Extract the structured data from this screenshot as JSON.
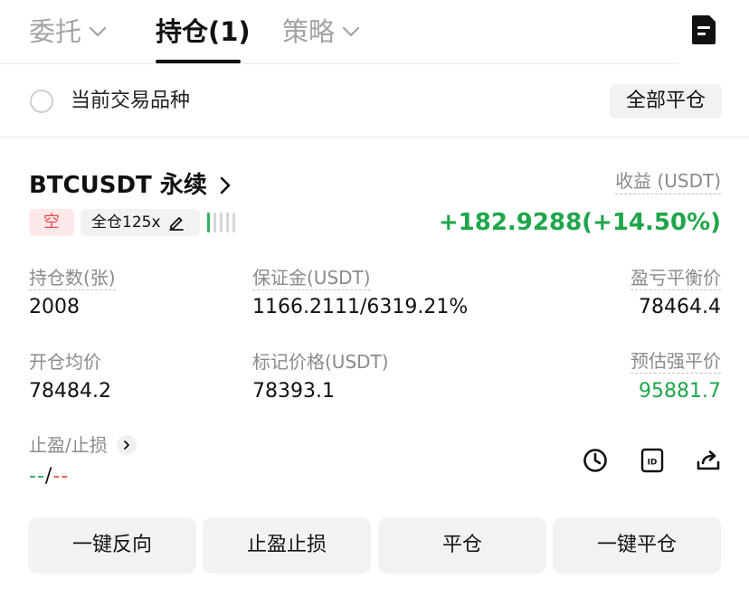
{
  "tabs": [
    {
      "label": "委托",
      "dropdown": true
    },
    {
      "label": "持仓(1)",
      "dropdown": false
    },
    {
      "label": "策略",
      "dropdown": true
    }
  ],
  "filter": {
    "current_symbol_label": "当前交易品种",
    "close_all_label": "全部平仓"
  },
  "position": {
    "symbol": "BTCUSDT 永续",
    "side": "空",
    "margin_mode": "全仓125x",
    "pnl_label": "收益 (USDT)",
    "pnl_value": "+182.9288(+14.50%)",
    "risk_bars_total": 5,
    "risk_bars_active": 1,
    "fields": {
      "size_label": "持仓数(张)",
      "size_value": "2008",
      "margin_label": "保证金(USDT)",
      "margin_value": "1166.2111/6319.21%",
      "breakeven_label": "盈亏平衡价",
      "breakeven_value": "78464.4",
      "entry_label": "开仓均价",
      "entry_value": "78484.2",
      "mark_label": "标记价格(USDT)",
      "mark_value": "78393.1",
      "liq_label": "预估强平价",
      "liq_value": "95881.7"
    },
    "tpsl": {
      "label": "止盈/止损",
      "tp": "--",
      "separator": "/",
      "sl": "--"
    }
  },
  "actions": {
    "reverse": "一键反向",
    "tpsl": "止盈止损",
    "close": "平仓",
    "close_all": "一键平仓"
  },
  "icons": {
    "history": "clock-icon",
    "id": "id-card-icon",
    "share": "share-icon",
    "document": "document-icon"
  },
  "colors": {
    "profit": "#1fa64b",
    "loss": "#e74c4c",
    "short_tag_bg": "#fde9e9",
    "muted": "#8a8a8a"
  }
}
